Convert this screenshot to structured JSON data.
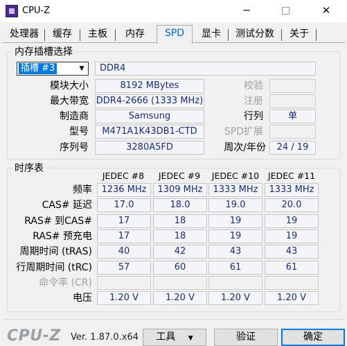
{
  "window": {
    "title": "CPU-Z",
    "min_glyph": "─",
    "close_glyph": "✕"
  },
  "tabs": [
    "处理器",
    "缓存",
    "主板",
    "内存",
    "SPD",
    "显卡",
    "测试分数",
    "关于"
  ],
  "slot_group": {
    "title": "内存插槽选择",
    "slot_selected": "插槽 #3",
    "memory_type": "DDR4",
    "labels": {
      "module_size": "模块大小",
      "max_bandwidth": "最大带宽",
      "manufacturer": "制造商",
      "part_number": "型号",
      "serial_number": "序列号",
      "correction": "校验",
      "registered": "注册",
      "ranks": "行列",
      "spd_ext": "SPD扩展",
      "week_year": "周次/年份"
    },
    "values": {
      "module_size": "8192 MBytes",
      "max_bandwidth": "DDR4-2666 (1333 MHz)",
      "manufacturer": "Samsung",
      "part_number": "M471A1K43DB1-CTD",
      "serial_number": "3280A5FD",
      "ranks": "单",
      "week_year": "24 / 19"
    }
  },
  "timings": {
    "title": "时序表",
    "columns": [
      "JEDEC #8",
      "JEDEC #9",
      "JEDEC #10",
      "JEDEC #11"
    ],
    "rows": [
      {
        "label": "频率",
        "values": [
          "1236 MHz",
          "1309 MHz",
          "1333 MHz",
          "1333 MHz"
        ],
        "dim": false
      },
      {
        "label": "CAS# 延迟",
        "values": [
          "17.0",
          "18.0",
          "19.0",
          "20.0"
        ],
        "dim": false
      },
      {
        "label": "RAS# 到CAS#",
        "values": [
          "17",
          "18",
          "19",
          "19"
        ],
        "dim": false
      },
      {
        "label": "RAS# 预充电",
        "values": [
          "17",
          "18",
          "19",
          "19"
        ],
        "dim": false
      },
      {
        "label": "周期时间 (tRAS)",
        "values": [
          "40",
          "42",
          "43",
          "43"
        ],
        "dim": false
      },
      {
        "label": "行周期时间 (tRC)",
        "values": [
          "57",
          "60",
          "61",
          "61"
        ],
        "dim": false
      },
      {
        "label": "命令率 (CR)",
        "values": [
          "",
          "",
          "",
          ""
        ],
        "dim": true
      },
      {
        "label": "电压",
        "values": [
          "1.20 V",
          "1.20 V",
          "1.20 V",
          "1.20 V"
        ],
        "dim": false
      }
    ]
  },
  "footer": {
    "brand": "CPU-Z",
    "version": "Ver. 1.87.0.x64",
    "tools_label": "工具",
    "validate_label": "验证",
    "ok_label": "确定"
  }
}
